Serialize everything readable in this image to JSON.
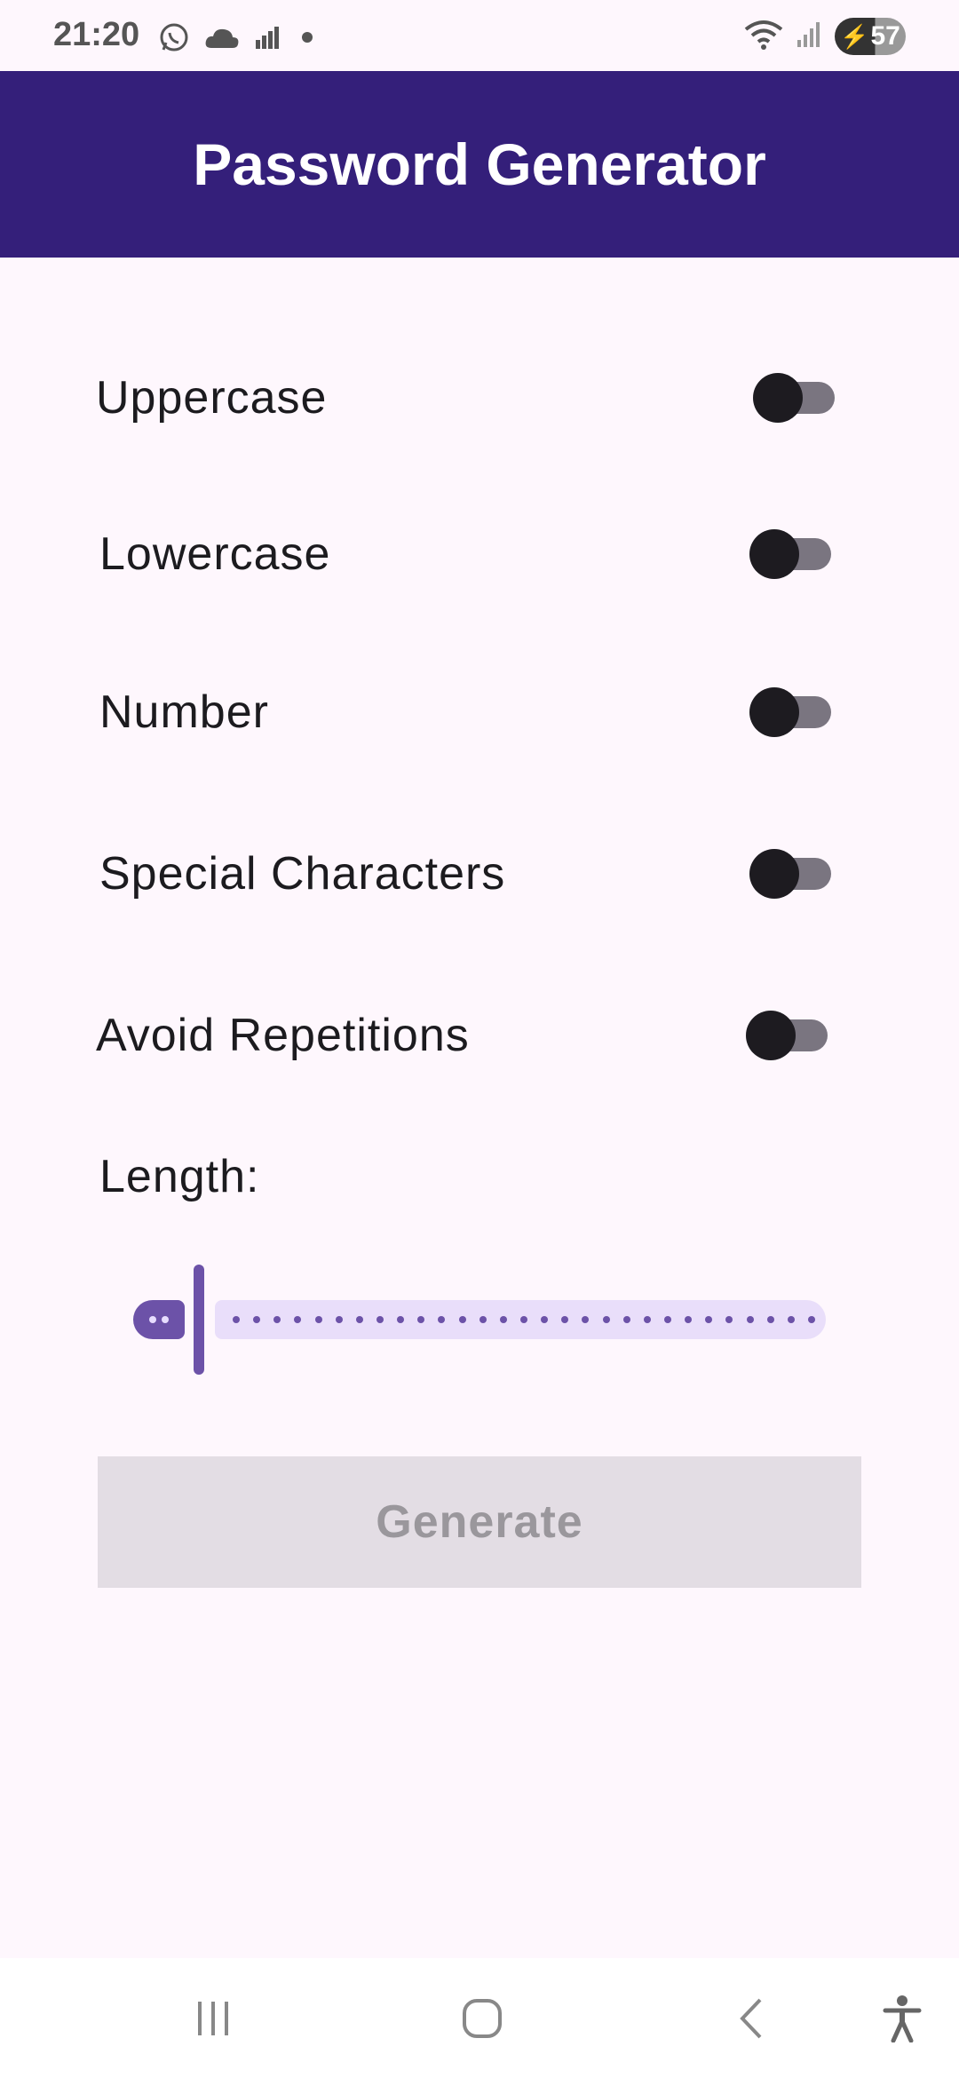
{
  "status_bar": {
    "time": "21:20",
    "battery_level": "57"
  },
  "app_bar": {
    "title": "Password Generator"
  },
  "options": [
    {
      "label": "Uppercase",
      "enabled": false
    },
    {
      "label": "Lowercase",
      "enabled": false
    },
    {
      "label": "Number",
      "enabled": false
    },
    {
      "label": "Special Characters",
      "enabled": false
    },
    {
      "label": "Avoid Repetitions",
      "enabled": false
    }
  ],
  "length": {
    "label": "Length:",
    "value_fraction": 0.0
  },
  "generate_button": {
    "label": "Generate",
    "enabled": false
  },
  "colors": {
    "app_bar": "#341f7a",
    "background": "#fef7fd",
    "slider_accent": "#6c52a8",
    "slider_track": "#e9defa",
    "switch_thumb": "#1d1b20",
    "switch_track": "#7a7580",
    "button_disabled_bg": "#e3dde4",
    "button_disabled_text": "#9a979c"
  },
  "icons": {
    "status_left": [
      "whatsapp-icon",
      "cloud-icon",
      "signal-bars-icon",
      "dot-icon"
    ],
    "status_right": [
      "wifi-icon",
      "cell-signal-icon",
      "battery-charging-icon"
    ],
    "nav": [
      "recents-icon",
      "home-icon",
      "back-icon",
      "accessibility-icon"
    ]
  }
}
